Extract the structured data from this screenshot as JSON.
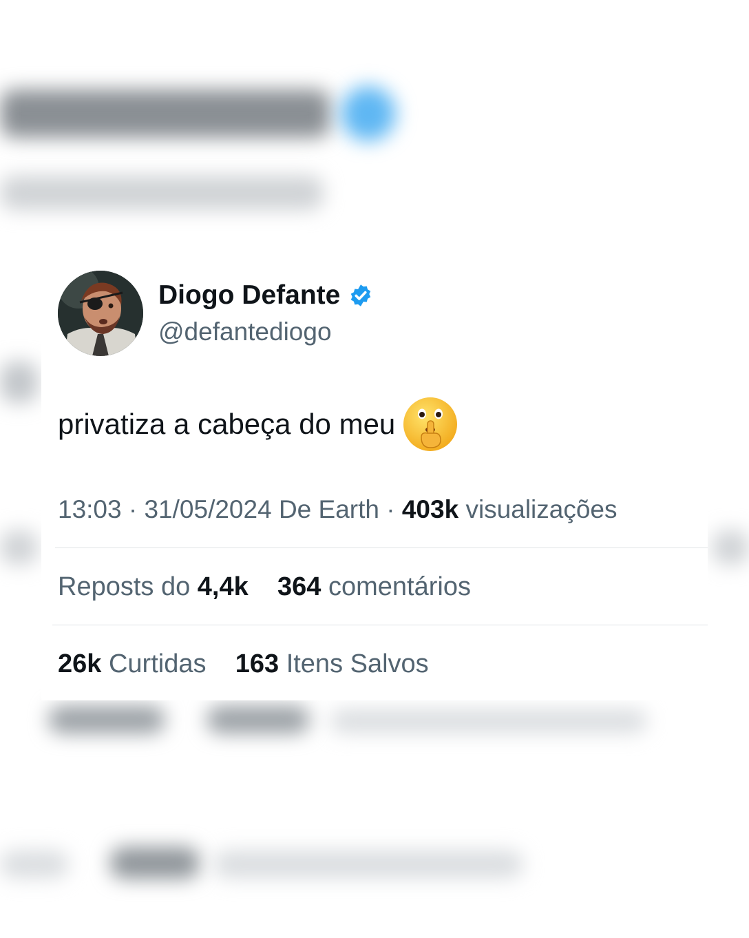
{
  "tweet": {
    "author_name": "Diogo Defante",
    "author_handle": "@defantediogo",
    "text": "privatiza a cabeça do meu",
    "emoji_icon": "shushing-face-icon",
    "time": "13:03",
    "date": "31/05/2024",
    "source": "De Earth",
    "views_count": "403k",
    "views_label": "visualizações",
    "reposts_label": "Reposts do",
    "reposts_count": "4,4k",
    "comments_count": "364",
    "comments_label": "comentários",
    "likes_count": "26k",
    "likes_label": "Curtidas",
    "bookmarks_count": "163",
    "bookmarks_label": "Itens Salvos"
  },
  "colors": {
    "verified_badge": "#1d9bf0",
    "text_primary": "#0f1419",
    "text_secondary": "#536471"
  }
}
